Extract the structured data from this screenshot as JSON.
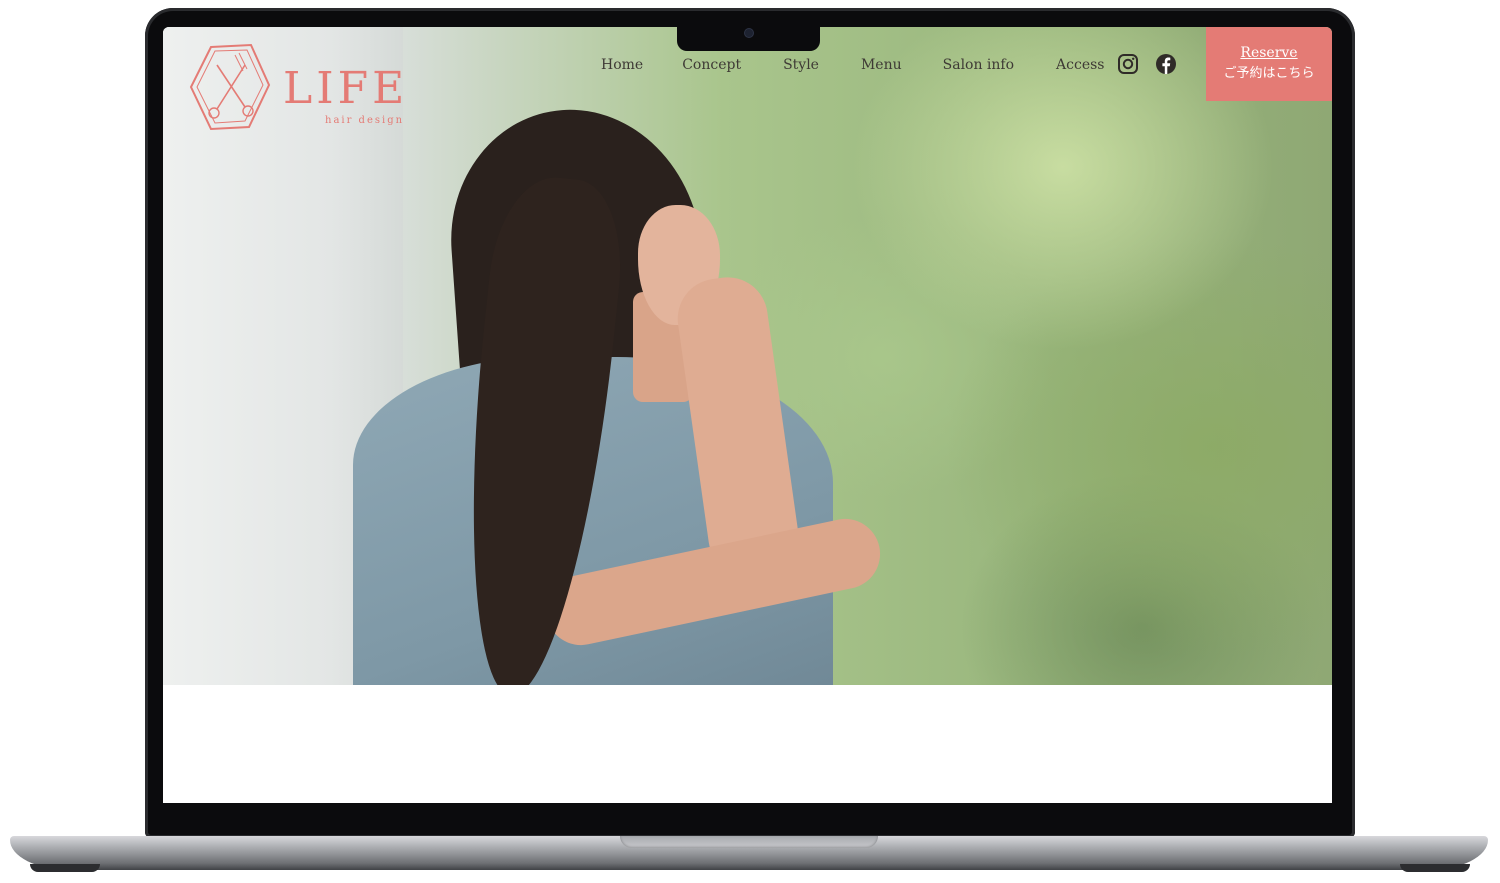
{
  "brand": {
    "name": "LIFE",
    "tagline": "hair design",
    "accent_color": "#e47b75"
  },
  "nav": {
    "items": [
      "Home",
      "Concept",
      "Style",
      "Menu",
      "Salon info",
      "Access"
    ]
  },
  "social": {
    "icons": [
      "instagram-icon",
      "facebook-icon"
    ]
  },
  "reserve": {
    "label_en": "Reserve",
    "label_ja": "ご予約はこちら"
  },
  "hero": {
    "image": "woman-with-long-hair-in-blue-dress-resting-chin-on-hand"
  }
}
